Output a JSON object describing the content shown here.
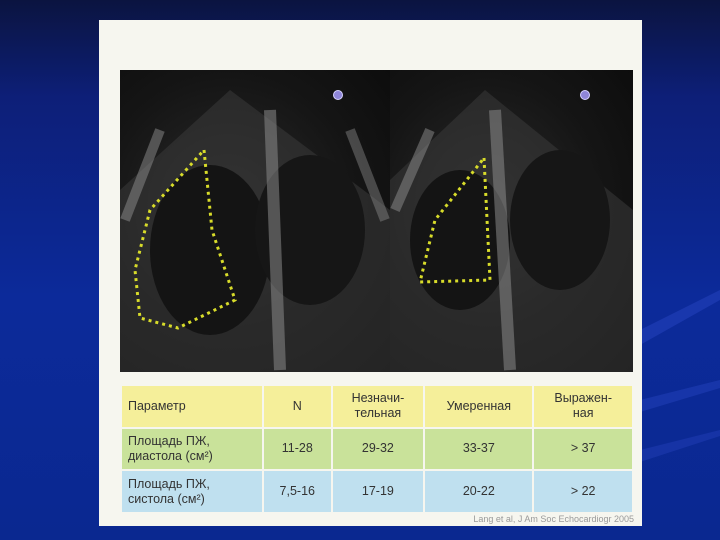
{
  "table": {
    "headers": [
      "Параметр",
      "N",
      "Незначи-\nтельная",
      "Умеренная",
      "Выражен-\nная"
    ],
    "rows": [
      {
        "label": "Площадь ПЖ,\nдиастола (см²)",
        "values": [
          "11-28",
          "29-32",
          "33-37",
          "> 37"
        ]
      },
      {
        "label": "Площадь ПЖ,\nсистола (см²)",
        "values": [
          "7,5-16",
          "17-19",
          "20-22",
          "> 22"
        ]
      }
    ]
  },
  "credit": "Lang et al, J Am Soc Echocardiogr 2005",
  "colors": {
    "header_bg": "#f5ef9a",
    "diastole_row_bg": "#c9e29a",
    "systole_row_bg": "#bfe0ef",
    "trace_color": "#d8dc2a",
    "background": "#0c2a9a"
  }
}
